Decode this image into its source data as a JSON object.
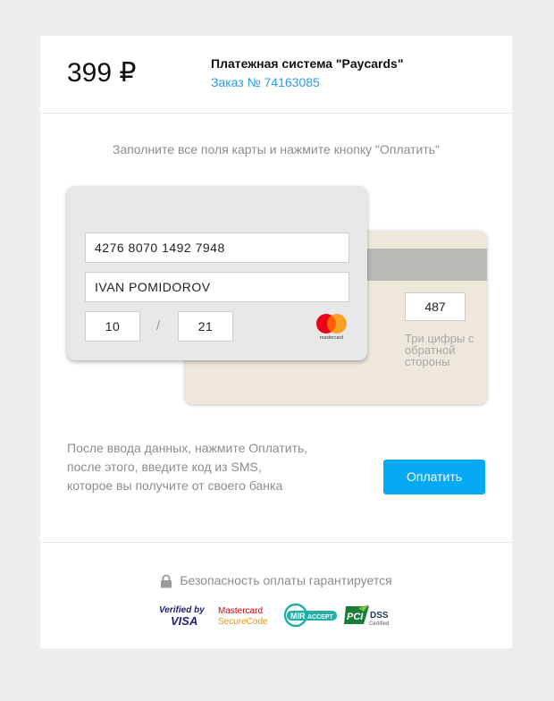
{
  "header": {
    "amount": "399 ₽",
    "merchant": "Платежная система \"Paycards\"",
    "order": "Заказ № 74163085"
  },
  "instruction": "Заполните все поля карты и нажмите кнопку \"Оплатить\"",
  "card_front": {
    "number": "4276 8070 1492 7948",
    "holder": "IVAN POMIDOROV",
    "month": "10",
    "separator": "/",
    "year": "21",
    "brand_logo": "mastercard-logo",
    "brand_logo_text": "mastercard"
  },
  "card_back": {
    "cvv": "487",
    "cvv_hint": "Три цифры с обратной стороны"
  },
  "note": "После ввода данных, нажмите Оплатить, после этого, введите код из SMS, которое вы получите от своего банка",
  "pay_button": "Оплатить",
  "security": {
    "text": "Безопасность оплаты гарантируется",
    "icon": "lock-icon",
    "badges": {
      "verified_visa_top": "Verified by",
      "verified_visa_bottom": "VISA",
      "mc_secure_top": "Mastercard",
      "mc_secure_bottom": "SecureCode",
      "mir_main": "MIR",
      "mir_sub": "ACCEPT",
      "pci_main": "PCI",
      "pci_dss": "DSS",
      "pci_sub": "Certified"
    }
  },
  "colors": {
    "accent": "#08a9f3",
    "link": "#2d9be6",
    "muted_text": "#8c8c8c",
    "card_back": "#eee8db",
    "card_front": "#e8e8e8"
  }
}
